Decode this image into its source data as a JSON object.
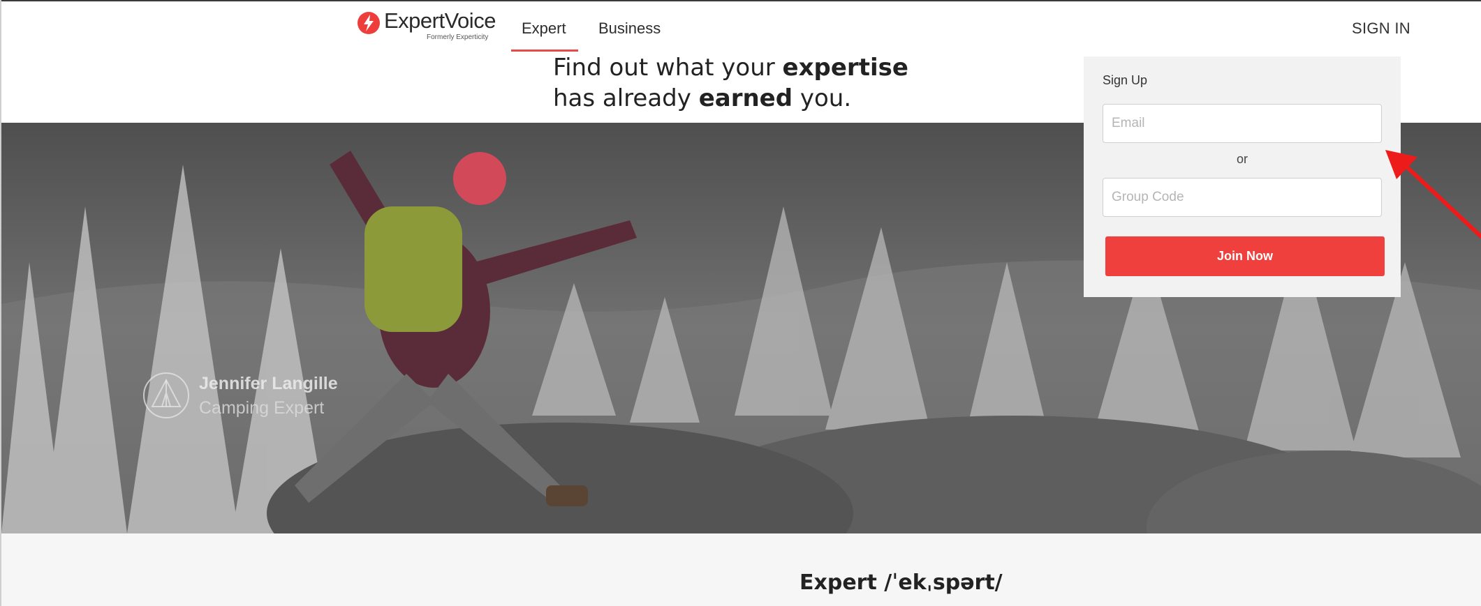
{
  "brand": {
    "name": "ExpertVoice",
    "subtitle": "Formerly Experticity",
    "accent_color": "#f0403e"
  },
  "nav": {
    "tabs": [
      {
        "label": "Expert",
        "active": true
      },
      {
        "label": "Business",
        "active": false
      }
    ],
    "sign_in_label": "SIGN IN"
  },
  "headline": {
    "line1_pre": "Find out what your ",
    "line1_bold": "expertise",
    "line2_pre": "has already ",
    "line2_bold": "earned",
    "line2_post": " you."
  },
  "hero": {
    "expert_name": "Jennifer Langille",
    "expert_role": "Camping Expert",
    "badge_icon": "tent-icon"
  },
  "signup": {
    "title": "Sign Up",
    "email_placeholder": "Email",
    "or_label": "or",
    "group_code_placeholder": "Group Code",
    "join_label": "Join Now"
  },
  "annotation": {
    "icon": "red-arrow-icon",
    "color": "#ee1b1b"
  },
  "definition": {
    "text": "Expert /ˈekˌspərt/"
  }
}
